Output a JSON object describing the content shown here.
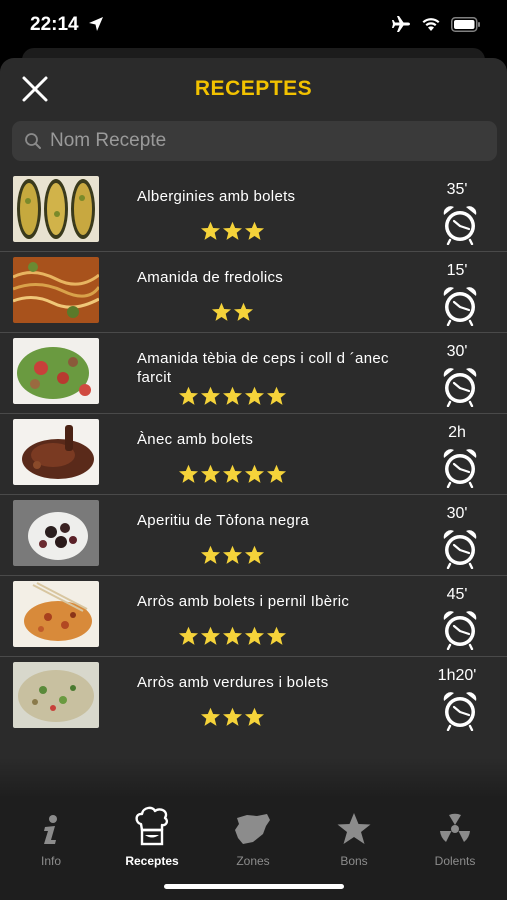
{
  "status_bar": {
    "time": "22:14",
    "icons": [
      "location-arrow-icon",
      "airplane-icon",
      "wifi-icon",
      "battery-icon"
    ]
  },
  "header": {
    "title": "RECEPTES",
    "close_icon": "close-icon",
    "title_color": "#f2c200"
  },
  "search": {
    "placeholder": "Nom Recepte",
    "value": ""
  },
  "recipes": [
    {
      "name": "Alberginies amb bolets",
      "stars": 3,
      "time": "35'"
    },
    {
      "name": "Amanida de fredolics",
      "stars": 2,
      "time": "15'"
    },
    {
      "name": "Amanida tèbia de ceps i coll  d ´anec farcit",
      "stars": 5,
      "time": "30'"
    },
    {
      "name": "Ànec amb bolets",
      "stars": 5,
      "time": "2h"
    },
    {
      "name": "Aperitiu de Tòfona negra",
      "stars": 3,
      "time": "30'"
    },
    {
      "name": "Arròs amb bolets i pernil Ibèric",
      "stars": 5,
      "time": "45'"
    },
    {
      "name": "Arròs amb verdures i bolets",
      "stars": 3,
      "time": "1h20'"
    }
  ],
  "tabs": [
    {
      "label": "Info",
      "icon": "info-icon",
      "active": false
    },
    {
      "label": "Receptes",
      "icon": "chef-icon",
      "active": true
    },
    {
      "label": "Zones",
      "icon": "map-icon",
      "active": false
    },
    {
      "label": "Bons",
      "icon": "star-icon",
      "active": false
    },
    {
      "label": "Dolents",
      "icon": "hazard-icon",
      "active": false
    }
  ],
  "colors": {
    "accent": "#f2c200",
    "star": "#f5d33a",
    "background": "#2b2b2b"
  }
}
